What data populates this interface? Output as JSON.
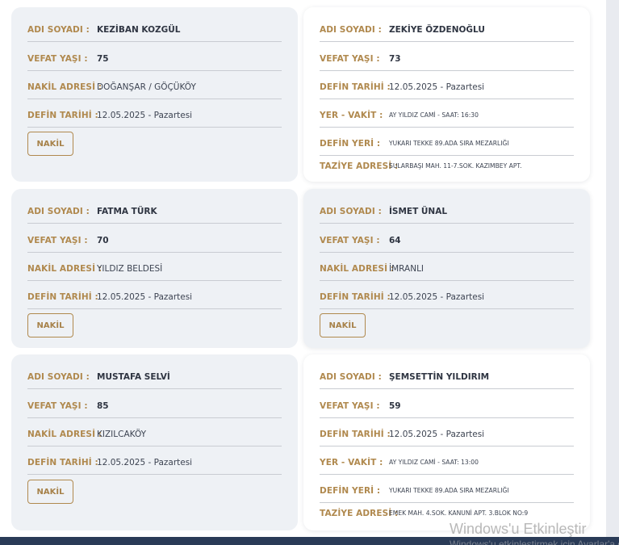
{
  "labels": {
    "name": "ADI SOYADI :",
    "age": "VEFAT YAŞI :",
    "address": "NAKİL ADRESİ :",
    "burial_date": "DEFİN TARİHİ :",
    "place_time": "YER - VAKİT :",
    "burial_place": "DEFİN YERİ :",
    "condolence_address": "TAZİYE ADRESİ :"
  },
  "cards": [
    {
      "name": "KEZİBAN KOZGÜL",
      "age": "75",
      "address": "DOĞANŞAR / GÖÇÜKÖY",
      "burial_date": "12.05.2025 - Pazartesi",
      "button": "NAKİL"
    },
    {
      "name": "ZEKİYE ÖZDENOĞLU",
      "age": "73",
      "burial_date": "12.05.2025 - Pazartesi",
      "place_time": "AY YILDIZ CAMİ - SAAT: 16:30",
      "burial_place": "YUKARI TEKKE 89.ADA SIRA MEZARLIĞI",
      "condolence_address": "SULARBAŞI MAH. 11-7.SOK. KAZIMBEY APT."
    },
    {
      "name": "FATMA TÜRK",
      "age": "70",
      "address": "YILDIZ BELDESİ",
      "burial_date": "12.05.2025 - Pazartesi",
      "button": "NAKİL"
    },
    {
      "name": "İSMET ÜNAL",
      "age": "64",
      "address": "İMRANLI",
      "burial_date": "12.05.2025 - Pazartesi",
      "button": "NAKİL"
    },
    {
      "name": "MUSTAFA SELVİ",
      "age": "85",
      "address": "KIZILCAKÖY",
      "burial_date": "12.05.2025 - Pazartesi",
      "button": "NAKİL"
    },
    {
      "name": "ŞEMSETTİN YILDIRIM",
      "age": "59",
      "burial_date": "12.05.2025 - Pazartesi",
      "place_time": "AY YILDIZ CAMİ - SAAT: 13:00",
      "burial_place": "YUKARI TEKKE 89.ADA SIRA MEZARLIĞI",
      "condolence_address": "EMEK MAH. 4.SOK. KANUNİ APT. 3.BLOK NO:9"
    }
  ],
  "watermark": {
    "title": "Windows'u Etkinleştir",
    "subtitle": "Windows'u etkinleştirmek için Ayarlar'a gidin"
  }
}
